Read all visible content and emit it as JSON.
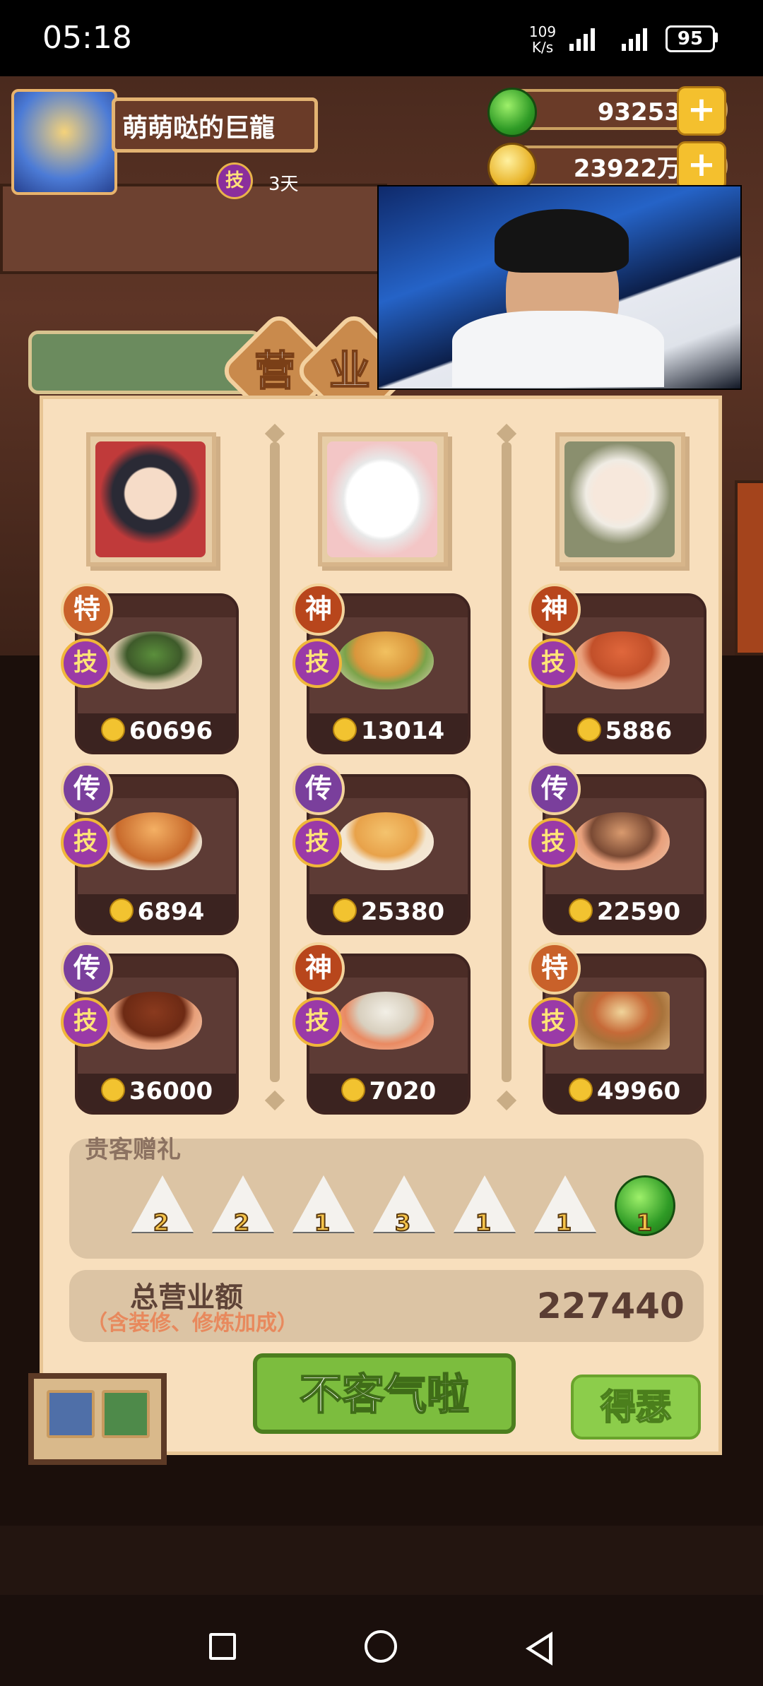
{
  "status_bar": {
    "time": "05:18",
    "net_speed_value": "109",
    "net_speed_unit": "K/s",
    "battery": "95"
  },
  "player": {
    "name": "萌萌哒的巨龍",
    "skill_badge": "技",
    "skill_days": "3天"
  },
  "currency": {
    "gems": "93253",
    "coins": "23922万",
    "plus": "+"
  },
  "tabs": [
    "营",
    "业"
  ],
  "chefs": [
    {
      "name": "chef-boy",
      "dishes": [
        {
          "grade": "特",
          "skill": "技",
          "price": "60696"
        },
        {
          "grade": "传",
          "skill": "技",
          "price": "6894"
        },
        {
          "grade": "传",
          "skill": "技",
          "price": "36000"
        }
      ]
    },
    {
      "name": "chef-hello-kitty",
      "dishes": [
        {
          "grade": "神",
          "skill": "技",
          "price": "13014"
        },
        {
          "grade": "传",
          "skill": "技",
          "price": "25380"
        },
        {
          "grade": "神",
          "skill": "技",
          "price": "7020"
        }
      ]
    },
    {
      "name": "chef-girl",
      "dishes": [
        {
          "grade": "神",
          "skill": "技",
          "price": "5886"
        },
        {
          "grade": "传",
          "skill": "技",
          "price": "22590"
        },
        {
          "grade": "特",
          "skill": "技",
          "price": "49960"
        }
      ]
    }
  ],
  "gifts": {
    "title": "贵客赠礼",
    "items": [
      "2",
      "2",
      "1",
      "3",
      "1",
      "1",
      "1"
    ]
  },
  "total": {
    "label": "总营业额",
    "sub": "（含装修、修炼加成）",
    "value": "227440"
  },
  "buttons": {
    "main": "不客气啦",
    "side": "得瑟"
  },
  "colors": {
    "panel": "#f8dfbd",
    "accent_green": "#7cbd3e",
    "dish_bg": "#5d3b35"
  }
}
